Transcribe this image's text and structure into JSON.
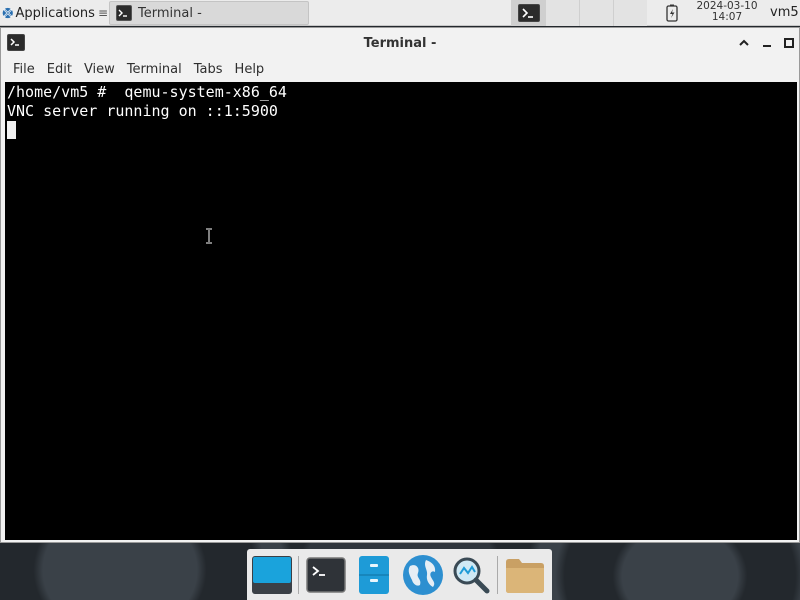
{
  "top_panel": {
    "applications_label": "Applications",
    "applications_extra": "≡",
    "task_label": "Terminal -",
    "clock_date": "2024-03-10",
    "clock_time": "14:07",
    "user": "vm5"
  },
  "window": {
    "title": "Terminal -",
    "menu": [
      "File",
      "Edit",
      "View",
      "Terminal",
      "Tabs",
      "Help"
    ]
  },
  "terminal": {
    "lines": [
      "/home/vm5 #  qemu-system-x86_64",
      "VNC server running on ::1:5900"
    ]
  },
  "dock": {
    "items": [
      {
        "icon": "show-desktop-icon"
      },
      {
        "icon": "terminal-icon"
      },
      {
        "icon": "file-manager-icon"
      },
      {
        "icon": "web-browser-icon"
      },
      {
        "icon": "search-icon"
      },
      {
        "icon": "folder-icon"
      }
    ]
  },
  "colors": {
    "panel_bg": "#ececec",
    "terminal_bg": "#000000",
    "terminal_fg": "#ffffff",
    "accent": "#1e9bd7"
  }
}
